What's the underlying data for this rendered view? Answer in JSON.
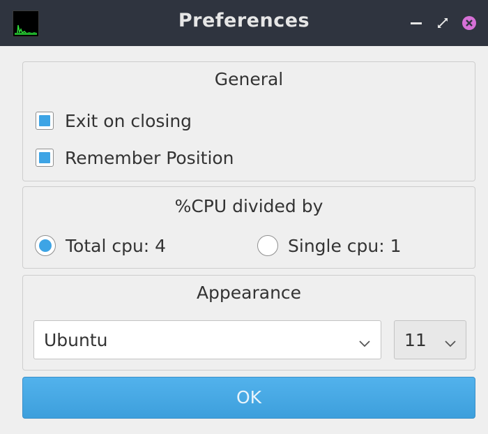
{
  "window": {
    "title": "Preferences",
    "controls": {
      "minimize_icon": "minimize-icon",
      "maximize_icon": "maximize-icon",
      "close_icon": "close-icon"
    },
    "app_icon": "cpu-monitor-icon"
  },
  "general": {
    "title": "General",
    "exit_on_closing": {
      "label": "Exit on closing",
      "checked": true
    },
    "remember_position": {
      "label": "Remember Position",
      "checked": true
    }
  },
  "cpu": {
    "title": "%CPU divided by",
    "options": [
      {
        "label": "Total cpu: 4",
        "selected": true
      },
      {
        "label": "Single cpu: 1",
        "selected": false
      }
    ]
  },
  "appearance": {
    "title": "Appearance",
    "font_value": "Ubuntu",
    "size_value": "11"
  },
  "ok_label": "OK",
  "colors": {
    "titlebar": "#2f343f",
    "accent": "#3da4e5",
    "close": "#d670d6",
    "background": "#efefef"
  }
}
